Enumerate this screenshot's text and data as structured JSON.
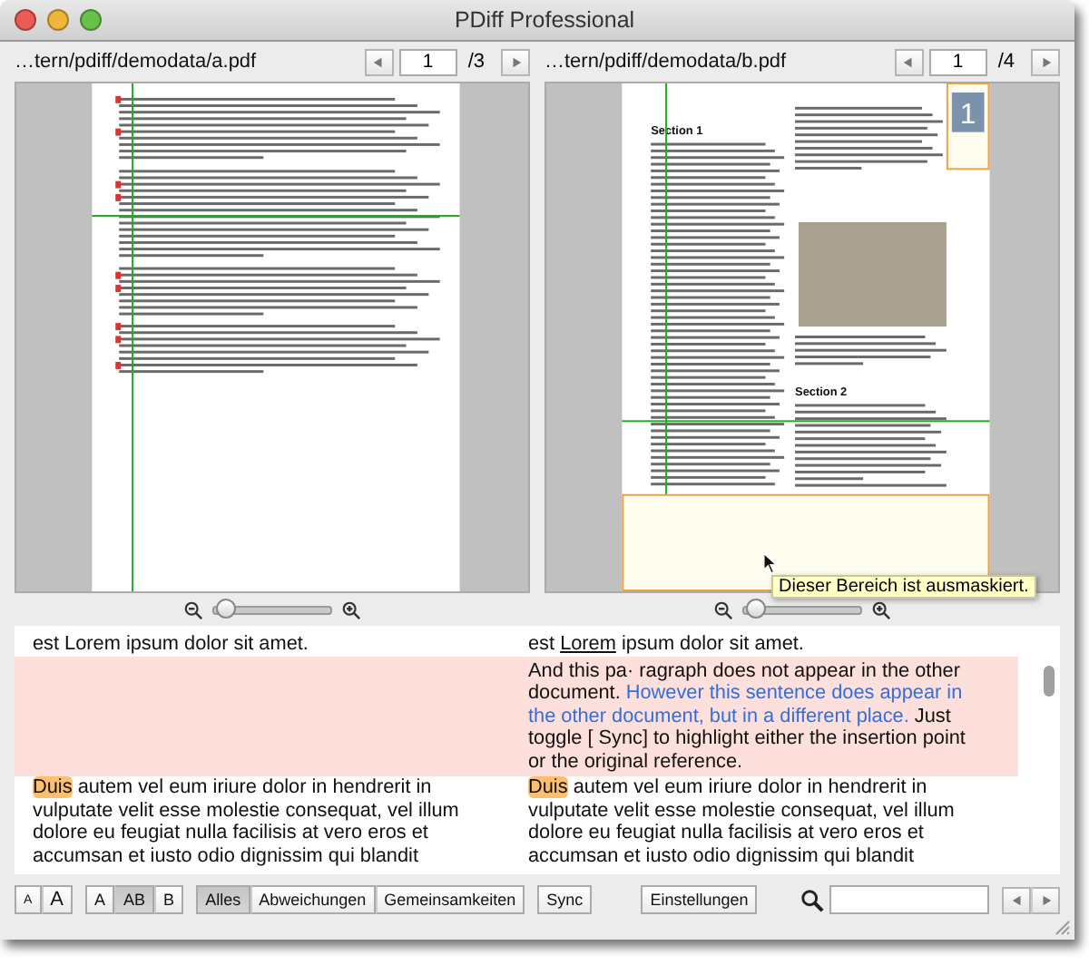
{
  "window": {
    "title": "PDiff Professional"
  },
  "documents": [
    {
      "kind": "single_column",
      "path": "…tern/pdiff/demodata/a.pdf",
      "page": "1",
      "page_count": "/3",
      "zoom": {
        "level": 0.08
      }
    },
    {
      "kind": "two_column",
      "path": "…tern/pdiff/demodata/b.pdf",
      "page": "1",
      "page_count": "/4",
      "zoom": {
        "level": 0.08
      },
      "headings": [
        "Section 1",
        "Section 2"
      ],
      "page_badge": "1",
      "masked_area": {
        "tooltip": "Dieser Bereich ist ausmaskiert."
      }
    }
  ],
  "compare": [
    {
      "paragraphs": [
        {
          "kind": "common",
          "lines": [
            [
              {
                "text": "est Lorem ipsum dolor sit amet.",
                "kind": "plain"
              }
            ]
          ]
        },
        {
          "kind": "gap"
        },
        {
          "kind": "common",
          "lines": [
            [
              {
                "text": "Duis",
                "kind": "highlight"
              },
              {
                "text": " autem vel eum iriure dolor in hendrerit in",
                "kind": "plain"
              }
            ],
            [
              {
                "text": "vulputate velit esse molestie consequat, vel illum",
                "kind": "plain"
              }
            ],
            [
              {
                "text": "dolore eu feugiat nulla facilisis at vero eros et",
                "kind": "plain"
              }
            ],
            [
              {
                "text": "accumsan et iusto odio dignissim qui blandit",
                "kind": "plain"
              }
            ]
          ]
        }
      ]
    },
    {
      "paragraphs": [
        {
          "kind": "common",
          "lines": [
            [
              {
                "text": "est ",
                "kind": "plain"
              },
              {
                "text": "Lorem",
                "kind": "underlined"
              },
              {
                "text": " ipsum dolor sit amet.",
                "kind": "plain"
              }
            ]
          ]
        },
        {
          "kind": "inserted",
          "lines": [
            [
              {
                "text": "And this pa· ragraph does not appear in the other",
                "kind": "plain"
              }
            ],
            [
              {
                "text": "document. ",
                "kind": "plain"
              },
              {
                "text": "However this sentence does appear in",
                "kind": "moved"
              }
            ],
            [
              {
                "text": "the other document, but in a different place.",
                "kind": "moved"
              },
              {
                "text": " Just",
                "kind": "plain"
              }
            ],
            [
              {
                "text": "toggle [ Sync] to highlight either the insertion point",
                "kind": "plain"
              }
            ],
            [
              {
                "text": "or the original reference.",
                "kind": "plain"
              }
            ]
          ]
        },
        {
          "kind": "common",
          "lines": [
            [
              {
                "text": "Duis",
                "kind": "highlight"
              },
              {
                "text": " autem vel eum iriure dolor in hendrerit in",
                "kind": "plain"
              }
            ],
            [
              {
                "text": "vulputate velit esse molestie consequat, vel illum",
                "kind": "plain"
              }
            ],
            [
              {
                "text": "dolore eu feugiat nulla facilisis at vero eros et",
                "kind": "plain"
              }
            ],
            [
              {
                "text": "accumsan et iusto odio dignissim qui blandit",
                "kind": "plain"
              }
            ]
          ]
        }
      ]
    }
  ],
  "toolbar": {
    "font_size_buttons": [
      {
        "label": "A",
        "kind": "smaller"
      },
      {
        "label": "A",
        "kind": "larger"
      }
    ],
    "view_mode": [
      {
        "label": "A",
        "selected": false
      },
      {
        "label": "AB",
        "selected": true
      },
      {
        "label": "B",
        "selected": false
      }
    ],
    "filter": [
      {
        "label": "Alles",
        "selected": true
      },
      {
        "label": "Abweichungen",
        "selected": false
      },
      {
        "label": "Gemeinsamkeiten",
        "selected": false
      }
    ],
    "sync_button": "Sync",
    "settings_button": "Einstellungen"
  }
}
